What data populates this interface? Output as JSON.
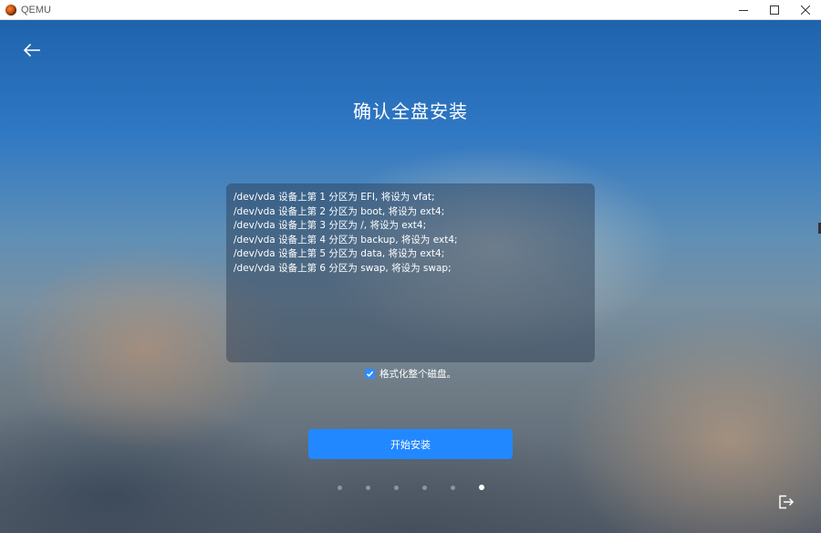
{
  "window": {
    "title": "QEMU",
    "icons": [
      "qemu-app-icon",
      "minimize-icon",
      "maximize-icon",
      "close-icon"
    ]
  },
  "header": {
    "back_icon": "arrow-left-icon",
    "title": "确认全盘安装"
  },
  "partition_info": {
    "lines": [
      "/dev/vda 设备上第 1 分区为 EFI, 将设为 vfat;",
      "/dev/vda 设备上第 2 分区为 boot, 将设为 ext4;",
      "/dev/vda 设备上第 3 分区为 /, 将设为 ext4;",
      "/dev/vda 设备上第 4 分区为 backup, 将设为 ext4;",
      "/dev/vda 设备上第 5 分区为 data, 将设为 ext4;",
      "/dev/vda 设备上第 6 分区为 swap, 将设为 swap;"
    ]
  },
  "format_option": {
    "label": "格式化整个磁盘。",
    "checked": true
  },
  "actions": {
    "start_label": "开始安装",
    "exit_icon": "exit-icon"
  },
  "pager": {
    "total": 6,
    "active_index": 5
  },
  "colors": {
    "accent": "#2288ff",
    "title_text": "#ffffff"
  }
}
